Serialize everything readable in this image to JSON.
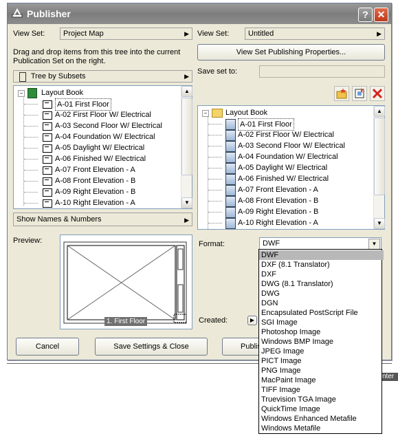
{
  "dialog": {
    "title": "Publisher",
    "help": "?",
    "close": "✕"
  },
  "left": {
    "view_set_label": "View Set:",
    "view_set_value": "Project Map",
    "instructions": "Drag and drop items from this tree into the current Publication Set on the right.",
    "tree_mode": "Tree by Subsets",
    "tree_root": "Layout Book",
    "tree_items": [
      "A-01 First Floor",
      "A-02 First Floor W/ Electrical",
      "A-03 Second Floor W/ Electrical",
      "A-04 Foundation W/ Electrical",
      "A-05 Daylight W/ Electrical",
      "A-06 Finished W/ Electrical",
      "A-07 Front Elevation - A",
      "A-08 Front Elevation - B",
      "A-09 Right Elevation - B",
      "A-10 Right Elevation - A"
    ],
    "show_names": "Show Names & Numbers",
    "preview_label": "Preview:",
    "preview_caption": "1. First Floor"
  },
  "right": {
    "view_set_label": "View Set:",
    "view_set_value": "Untitled",
    "properties_button": "View Set Publishing Properties...",
    "save_set_label": "Save set to:",
    "tree_root": "Layout Book",
    "tree_items": [
      "A-01 First Floor",
      "A-02 First Floor W/ Electrical",
      "A-03 Second Floor W/ Electrical",
      "A-04 Foundation W/ Electrical",
      "A-05 Daylight W/ Electrical",
      "A-06 Finished W/ Electrical",
      "A-07 Front Elevation - A",
      "A-08 Front Elevation - B",
      "A-09 Right Elevation - B",
      "A-10 Right Elevation - A"
    ],
    "format_label": "Format:",
    "format_value": "DWF",
    "created_label": "Created:",
    "formats": [
      "DWF",
      "DXF (8.1 Translator)",
      "DXF",
      "DWG (8.1 Translator)",
      "DWG",
      "DGN",
      "Encapsulated PostScript File",
      "SGI Image",
      "Photoshop Image",
      "Windows BMP Image",
      "JPEG Image",
      "PICT Image",
      "PNG Image",
      "MacPaint Image",
      "TIFF Image",
      "Truevision TGA Image",
      "QuickTime Image",
      "Windows Enhanced Metafile",
      "Windows Metafile"
    ],
    "selected_format_index": 0
  },
  "footer": {
    "cancel": "Cancel",
    "save_close": "Save Settings & Close",
    "publish_partial": "Publis"
  },
  "background": {
    "right_label": "nter"
  }
}
